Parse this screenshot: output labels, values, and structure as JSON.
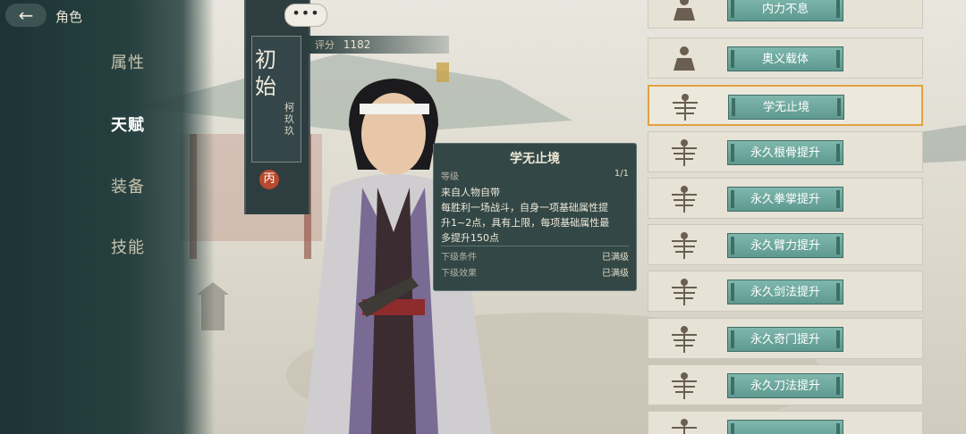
{
  "header": {
    "back_icon": "arrow-left-icon",
    "title": "角色"
  },
  "nav": [
    {
      "label": "属性",
      "active": false
    },
    {
      "label": "天赋",
      "active": true
    },
    {
      "label": "装备",
      "active": false
    },
    {
      "label": "技能",
      "active": false
    }
  ],
  "more_label": "•••",
  "character": {
    "rank": "初始",
    "name": "柯玖玖",
    "grade": "丙",
    "score_label": "评分",
    "score_value": "1182"
  },
  "tooltip": {
    "title": "学无止境",
    "level_label": "等级",
    "level_value": "1/1",
    "description_lines": [
      "来自人物自带",
      "每胜利一场战斗，自身一项基础属性提",
      "升1~2点，具有上限，每项基础属性最",
      "多提升150点"
    ],
    "next_condition_label": "下级条件",
    "next_condition_value": "已满级",
    "next_effect_label": "下级效果",
    "next_effect_value": "已满级"
  },
  "skills": [
    {
      "label": "内力不息",
      "icon": "meditation-icon",
      "selected": false
    },
    {
      "label": "奥义载体",
      "icon": "meditation-icon",
      "selected": false
    },
    {
      "label": "学无止境",
      "icon": "multi-arm-deity-icon",
      "selected": true
    },
    {
      "label": "永久根骨提升",
      "icon": "multi-arm-deity-icon",
      "selected": false
    },
    {
      "label": "永久拳掌提升",
      "icon": "multi-arm-deity-icon",
      "selected": false
    },
    {
      "label": "永久臂力提升",
      "icon": "multi-arm-deity-icon",
      "selected": false
    },
    {
      "label": "永久剑法提升",
      "icon": "multi-arm-deity-icon",
      "selected": false
    },
    {
      "label": "永久奇门提升",
      "icon": "multi-arm-deity-icon",
      "selected": false
    },
    {
      "label": "永久刀法提升",
      "icon": "multi-arm-deity-icon",
      "selected": false
    },
    {
      "label": "",
      "icon": "multi-arm-deity-icon",
      "selected": false
    }
  ],
  "colors": {
    "sidebar": "#26403f",
    "accent_selected": "#e2a240",
    "skill_button": "#6fa89f"
  }
}
